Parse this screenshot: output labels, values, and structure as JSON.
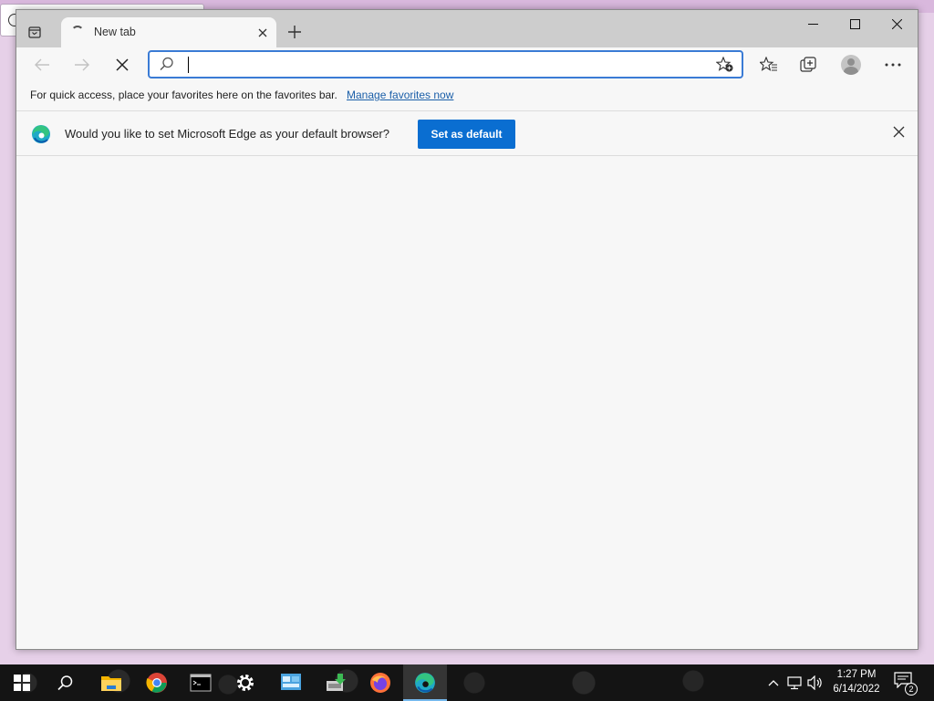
{
  "browser": {
    "tab": {
      "title": "New tab",
      "state": "loading"
    },
    "address_bar": {
      "value": "",
      "placeholder": ""
    },
    "favorites_bar": {
      "message": "For quick access, place your favorites here on the favorites bar.",
      "link": "Manage favorites now"
    },
    "infobar": {
      "prompt": "Would you like to set Microsoft Edge as your default browser?",
      "button": "Set as default"
    },
    "accent_color": "#0a6ed1"
  },
  "taskbar": {
    "apps": [
      "start-icon",
      "search-icon",
      "file-explorer-icon",
      "chrome-icon",
      "terminal-icon",
      "settings-icon",
      "control-panel-icon",
      "installer-icon",
      "firefox-icon",
      "edge-icon"
    ],
    "active_app": "edge-icon",
    "clock": {
      "time": "1:27 PM",
      "date": "6/14/2022"
    },
    "notifications": "2"
  }
}
